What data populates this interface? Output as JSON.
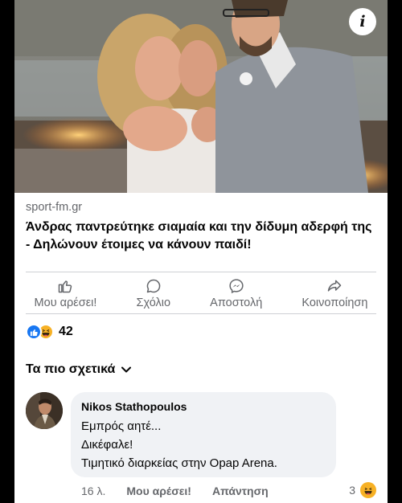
{
  "post": {
    "image_alt": "",
    "link": {
      "domain": "sport-fm.gr",
      "headline": "Άνδρας παντρεύτηκε σιαμαία και την δίδυμη αδερφή της - Δηλώνουν έτοιμες να κάνουν παιδί!"
    },
    "actions": [
      {
        "label": "Μου αρέσει!",
        "icon": "like-icon"
      },
      {
        "label": "Σχόλιο",
        "icon": "comment-icon"
      },
      {
        "label": "Αποστολή",
        "icon": "messenger-icon"
      },
      {
        "label": "Κοινοποίηση",
        "icon": "share-icon"
      }
    ],
    "reactions": {
      "types": [
        "like",
        "haha"
      ],
      "count": "42"
    }
  },
  "comments_sort": {
    "label": "Τα πιο σχετικά"
  },
  "comment": {
    "author": "Nikos Stathopoulos",
    "lines": [
      "Εμπρός αητέ...",
      "Δικέφαλε!",
      "Τιμητικό διαρκείας στην Opap Arena."
    ],
    "time": "16 λ.",
    "like_label": "Μου αρέσει!",
    "reply_label": "Απάντηση",
    "reaction_count": "3"
  },
  "colors": {
    "accent": "#1877f2",
    "secondary_text": "#65676b",
    "bubble": "#f0f2f5",
    "haha": "#f7b125"
  }
}
